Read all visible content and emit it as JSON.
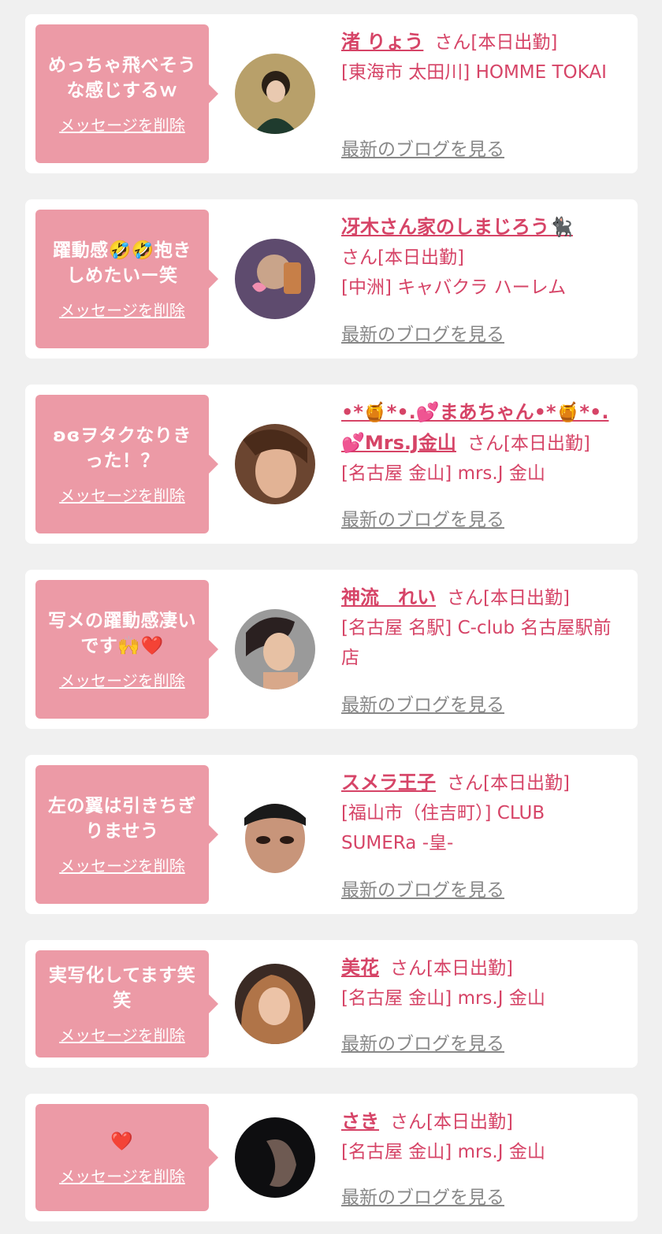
{
  "blog_link_label": "最新のブログを見る",
  "delete_label": "メッセージを削除",
  "status_suffix": "さん[本日出勤]",
  "colors": {
    "background": "#f0f0f0",
    "bubble": "#ec9aa6",
    "name": "#d64467",
    "link_gray": "#888888"
  },
  "items": [
    {
      "message": "めっちゃ飛べそうな感じするｗ",
      "name": "渚 りょう",
      "shop": "[東海市 太田川] HOMME TOKAI"
    },
    {
      "message": "躍動感🤣🤣抱きしめたいー笑",
      "name": "冴木さん家のしまじろう🐈‍⬛",
      "shop": "[中洲] キャバクラ ハーレム"
    },
    {
      "message": "ʚɞヲタクなりきった！？",
      "name": "•*🍯*•.💕まあちゃん•*🍯*•.💕Mrs.J金山",
      "shop": "[名古屋 金山] mrs.J 金山"
    },
    {
      "message": "写メの躍動感凄いです🙌❤️",
      "name": "神流　れい",
      "shop": "[名古屋 名駅] C-club 名古屋駅前店"
    },
    {
      "message": "左の翼は引きちぎりませう",
      "name": "スメラ王子",
      "shop": "[福山市（住吉町）] CLUB SUMERa -皇-"
    },
    {
      "message": "実写化してます笑笑",
      "name": "美花",
      "shop": "[名古屋 金山] mrs.J 金山"
    },
    {
      "message": "❤️",
      "name": "さき",
      "shop": "[名古屋 金山] mrs.J 金山"
    }
  ]
}
